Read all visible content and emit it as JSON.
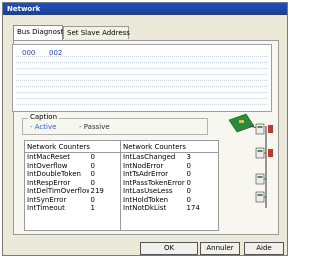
{
  "window": {
    "title": "Network"
  },
  "tabs": [
    {
      "label": "Bus Diagnostic"
    },
    {
      "label": "Set Slave Address"
    }
  ],
  "bus": {
    "addresses": [
      "000",
      "002"
    ]
  },
  "caption": {
    "title": "Caption",
    "active_label": "Active",
    "passive_label": "Passive"
  },
  "counters": {
    "left": {
      "header": "Network Counters",
      "rows": [
        {
          "name": "IntMacReset",
          "value": "0"
        },
        {
          "name": "IntOverflow",
          "value": "0"
        },
        {
          "name": "IntDoubleToken",
          "value": "0"
        },
        {
          "name": "IntRespError",
          "value": "0"
        },
        {
          "name": "IntDelTimOverflow",
          "value": "219"
        },
        {
          "name": "IntSynError",
          "value": "0"
        },
        {
          "name": "IntTimeout",
          "value": "1"
        }
      ]
    },
    "right": {
      "header": "Network Counters",
      "rows": [
        {
          "name": "IntLasChanged",
          "value": "3"
        },
        {
          "name": "IntNodError",
          "value": "0"
        },
        {
          "name": "IntTsAdrError",
          "value": "0"
        },
        {
          "name": "IntPassTokenError",
          "value": "0"
        },
        {
          "name": "IntLasUseLess",
          "value": "0"
        },
        {
          "name": "IntHoldToken",
          "value": "0"
        },
        {
          "name": "IntNotDkList",
          "value": "174"
        }
      ]
    }
  },
  "buttons": {
    "ok": "OK",
    "cancel": "Annuler",
    "help": "Aide"
  },
  "colors": {
    "title_bar": "#1f4fbf",
    "active": "#2a62d8",
    "address": "#1a3fd6"
  }
}
